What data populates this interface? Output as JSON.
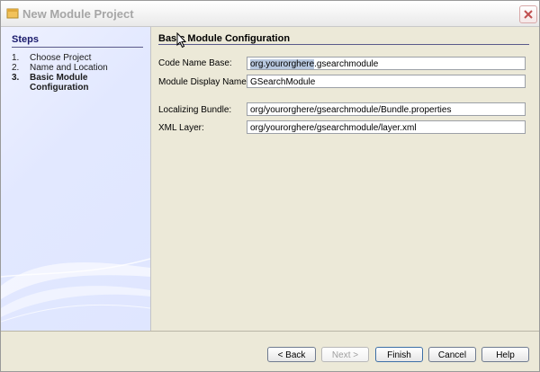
{
  "window": {
    "title": "New Module Project"
  },
  "steps": {
    "title": "Steps",
    "items": [
      {
        "num": "1.",
        "label": "Choose Project"
      },
      {
        "num": "2.",
        "label": "Name and Location"
      },
      {
        "num": "3.",
        "label": "Basic Module",
        "label2": "Configuration"
      }
    ]
  },
  "panel": {
    "title": "Basic Module Configuration",
    "code_name_base": {
      "label": "Code Name Base:",
      "value_selected": "org.yourorghere",
      "value_rest": ".gsearchmodule"
    },
    "module_display_name": {
      "label": "Module Display Name:",
      "value": "GSearchModule"
    },
    "localizing_bundle": {
      "label": "Localizing Bundle:",
      "value": "org/yourorghere/gsearchmodule/Bundle.properties"
    },
    "xml_layer": {
      "label": "XML Layer:",
      "value": "org/yourorghere/gsearchmodule/layer.xml"
    }
  },
  "buttons": {
    "back": "< Back",
    "next": "Next >",
    "finish": "Finish",
    "cancel": "Cancel",
    "help": "Help"
  }
}
